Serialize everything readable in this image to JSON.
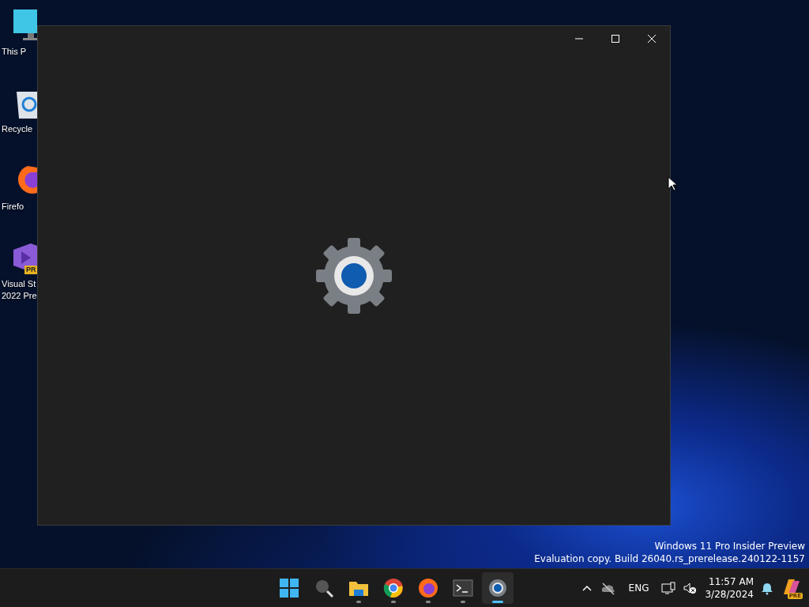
{
  "desktop_icons": [
    {
      "kind": "monitor",
      "lines": [
        "This P"
      ]
    },
    {
      "kind": "recycle",
      "lines": [
        "Recycle"
      ]
    },
    {
      "kind": "firefox",
      "lines": [
        "Firefo"
      ]
    },
    {
      "kind": "vs",
      "lines": [
        "Visual St",
        "2022 Pre"
      ],
      "badge": "PR"
    }
  ],
  "window": {
    "controls": [
      {
        "kind": "minimize"
      },
      {
        "kind": "maximize"
      },
      {
        "kind": "close"
      }
    ]
  },
  "watermark": {
    "lines": [
      "Windows 11 Pro Insider Preview",
      "Evaluation copy. Build 26040.rs_prerelease.240122-1157"
    ]
  },
  "taskbar": {
    "apps": [
      {
        "kind": "start",
        "running": false,
        "selected": false
      },
      {
        "kind": "search",
        "running": false,
        "selected": false
      },
      {
        "kind": "folder",
        "running": true,
        "selected": false
      },
      {
        "kind": "chrome",
        "running": true,
        "selected": false
      },
      {
        "kind": "firefox",
        "running": true,
        "selected": false
      },
      {
        "kind": "terminal",
        "running": true,
        "selected": false
      },
      {
        "kind": "settings",
        "running": true,
        "selected": true
      }
    ],
    "tray": {
      "language": "ENG",
      "time": "11:57 AM",
      "date": "3/28/2024",
      "badge": "PRE"
    }
  }
}
